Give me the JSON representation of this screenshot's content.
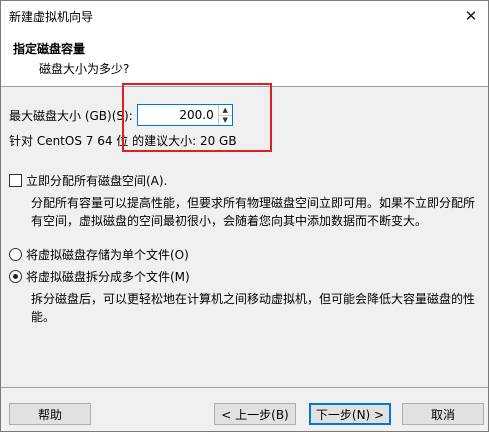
{
  "window": {
    "title": "新建虚拟机向导",
    "close_glyph": "✕"
  },
  "header": {
    "title": "指定磁盘容量",
    "subtitle": "磁盘大小为多少?"
  },
  "disk_size": {
    "label": "最大磁盘大小 (GB)(S):",
    "value": "200.0",
    "recommendation": "针对 CentOS 7 64 位 的建议大小: 20 GB"
  },
  "allocate": {
    "checkbox_label": "立即分配所有磁盘空间(A).",
    "checked": false,
    "description": "分配所有容量可以提高性能，但要求所有物理磁盘空间立即可用。如果不立即分配所有空间，虚拟磁盘的空间最初很小，会随着您向其中添加数据而不断变大。"
  },
  "storage_options": [
    {
      "label": "将虚拟磁盘存储为单个文件(O)",
      "selected": false
    },
    {
      "label": "将虚拟磁盘拆分成多个文件(M)",
      "selected": true
    }
  ],
  "split_description": "拆分磁盘后，可以更轻松地在计算机之间移动虚拟机，但可能会降低大容量磁盘的性能。",
  "buttons": {
    "help": "帮助",
    "back": "< 上一步(B)",
    "next": "下一步(N) >",
    "cancel": "取消"
  },
  "icons": {
    "spin_up": "up-arrow-icon",
    "spin_down": "down-arrow-icon"
  },
  "colors": {
    "highlight_box": "#e02020",
    "focus_border": "#0078d7"
  }
}
